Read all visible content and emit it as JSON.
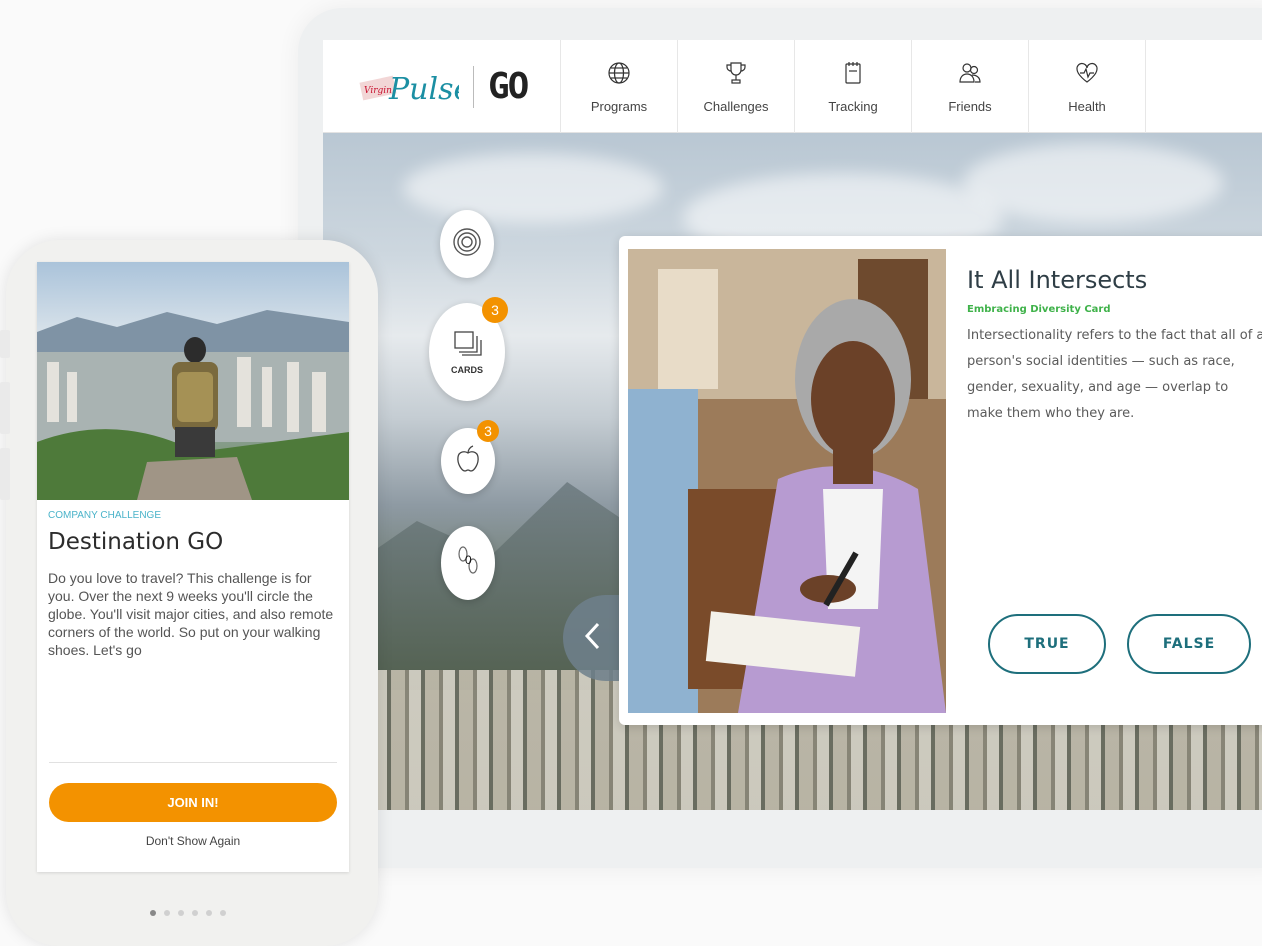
{
  "brand": {
    "logo_script": "Pulse",
    "logo_small": "Virgin",
    "logo_go": "GO"
  },
  "nav": {
    "items": [
      {
        "label": "Programs",
        "icon": "globe-icon"
      },
      {
        "label": "Challenges",
        "icon": "trophy-icon"
      },
      {
        "label": "Tracking",
        "icon": "notepad-icon"
      },
      {
        "label": "Friends",
        "icon": "friends-icon"
      },
      {
        "label": "Health",
        "icon": "heart-pulse-icon"
      }
    ]
  },
  "sidebar": {
    "cards_label": "CARDS",
    "cards_badge": "3",
    "nutrition_badge": "3",
    "steps_count": "0"
  },
  "card": {
    "title": "It All Intersects",
    "subtitle": "Embracing Diversity Card",
    "body": "Intersectionality refers to the fact that all of a person's social identities — such as race, gender, sexuality, and age — overlap to make them who they are.",
    "true_label": "TRUE",
    "false_label": "FALSE"
  },
  "phone": {
    "kicker": "COMPANY CHALLENGE",
    "title": "Destination GO",
    "description": "Do you love to travel? This challenge is for you. Over the next 9 weeks you'll circle the globe. You'll visit major cities, and also remote corners of the world. So put on your walking shoes. Let's go",
    "join_label": "JOIN IN!",
    "dont_show_label": "Don't Show Again",
    "page_count": 6,
    "active_page": 1
  },
  "colors": {
    "accent_orange": "#f39200",
    "teal": "#1e6f7c",
    "green": "#3fb24a",
    "kicker_blue": "#4ab3c9"
  }
}
